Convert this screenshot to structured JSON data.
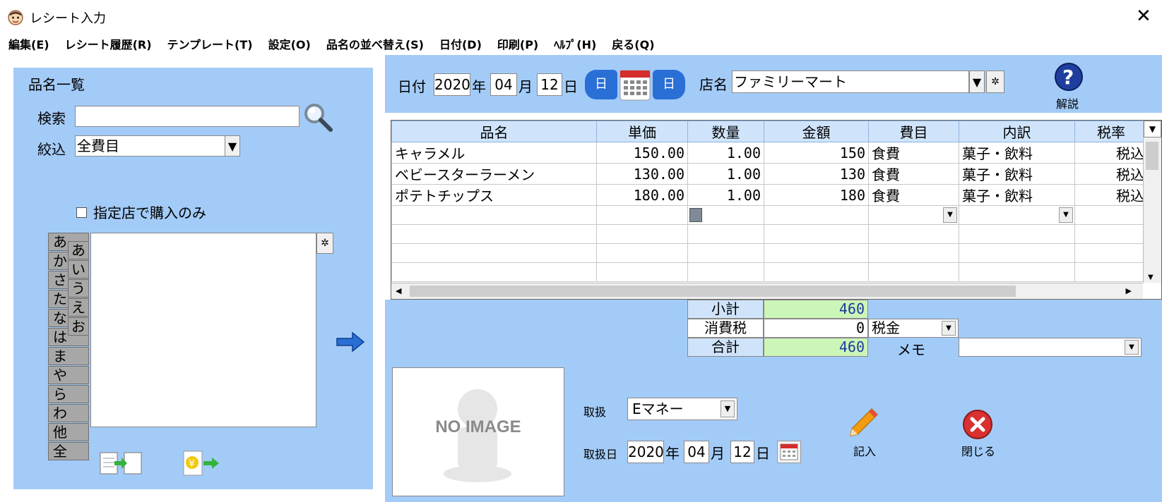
{
  "window": {
    "title": "レシート入力",
    "close_glyph": "✕"
  },
  "menu": [
    "編集(E)",
    "レシート履歴(R)",
    "テンプレート(T)",
    "設定(O)",
    "品名の並べ替え(S)",
    "日付(D)",
    "印刷(P)",
    "ﾍﾙﾌﾟ(H)",
    "戻る(Q)"
  ],
  "left": {
    "section_title": "品名一覧",
    "search_label": "検索",
    "search_value": "",
    "filter_label": "絞込",
    "filter_value": "全費目",
    "only_store_label": "指定店で購入のみ",
    "only_store_checked": false,
    "kana_tabs": [
      "あ",
      "か",
      "さ",
      "た",
      "な",
      "は",
      "ま",
      "や",
      "ら",
      "わ",
      "他",
      "全"
    ],
    "kana_sub": [
      "あ",
      "い",
      "う",
      "え",
      "お"
    ]
  },
  "header": {
    "date_label": "日付",
    "year": "2020",
    "year_unit": "年",
    "month": "04",
    "month_unit": "月",
    "day": "12",
    "day_unit": "日",
    "prev_day_label": "日",
    "next_day_label": "日",
    "store_label": "店名",
    "store_value": "ファミリーマート",
    "help_label": "解説"
  },
  "grid": {
    "columns": [
      "品名",
      "単価",
      "数量",
      "金額",
      "費目",
      "内訳",
      "税率"
    ],
    "rows": [
      [
        "キャラメル",
        "150.00",
        "1.00",
        "150",
        "食費",
        "菓子・飲料",
        "税込"
      ],
      [
        "ベビースターラーメン",
        "130.00",
        "1.00",
        "130",
        "食費",
        "菓子・飲料",
        "税込"
      ],
      [
        "ポテトチップス",
        "180.00",
        "1.00",
        "180",
        "食費",
        "菓子・飲料",
        "税込"
      ]
    ]
  },
  "totals": {
    "subtotal_label": "小計",
    "subtotal": "460",
    "tax_label": "消費税",
    "tax": "0",
    "tax_type": "税金",
    "total_label": "合計",
    "total": "460",
    "memo_label": "メモ",
    "memo_value": ""
  },
  "bottom": {
    "noimage_text": "NO IMAGE",
    "handling_label": "取扱",
    "handling_value": "Eマネー",
    "handling_date_label": "取扱日",
    "h_year": "2020",
    "h_year_unit": "年",
    "h_month": "04",
    "h_month_unit": "月",
    "h_day": "12",
    "h_day_unit": "日",
    "record_label": "記入",
    "close_label": "閉じる"
  },
  "colors": {
    "panel": "#a3cbf7",
    "header_cell": "#cfe4fb",
    "total_cell": "#ccf5b8",
    "accent_blue": "#2a6fd6"
  }
}
